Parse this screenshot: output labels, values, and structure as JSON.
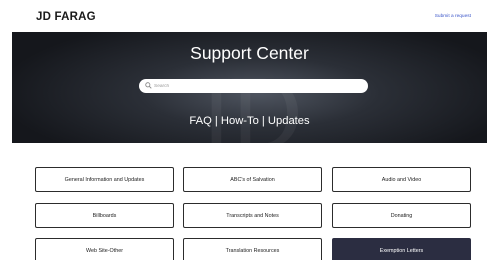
{
  "header": {
    "brand": "JD FARAG",
    "submit_request": "Submit a request"
  },
  "hero": {
    "title": "Support Center",
    "search_placeholder": "Search",
    "subtitle": "FAQ | How-To | Updates"
  },
  "categories": [
    {
      "label": "General Information and Updates"
    },
    {
      "label": "ABC's of Salvation"
    },
    {
      "label": "Audio and Video"
    },
    {
      "label": "Billboards"
    },
    {
      "label": "Transcripts and Notes"
    },
    {
      "label": "Donating"
    },
    {
      "label": "Web Site-Other"
    },
    {
      "label": "Translation Resources"
    },
    {
      "label": "Exemption Letters",
      "highlighted": true
    }
  ],
  "colors": {
    "link": "#3a55c9",
    "hero_background": "#2b2f37",
    "highlight_button": "#2b2d41"
  }
}
